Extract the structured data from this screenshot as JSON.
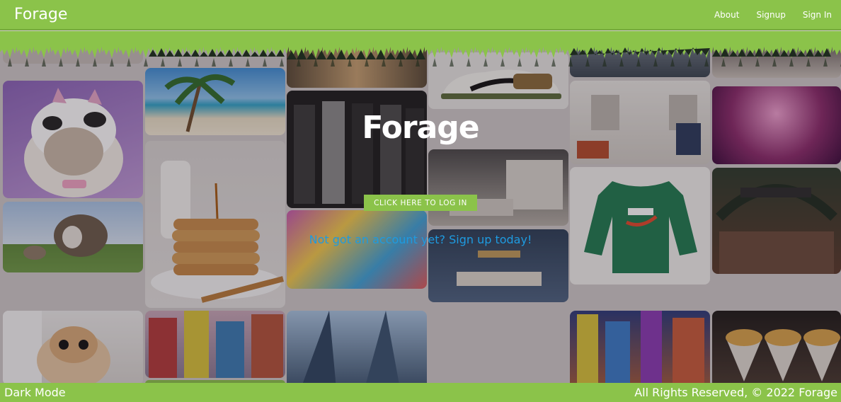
{
  "navbar": {
    "brand": "Forage",
    "links": [
      {
        "label": "About"
      },
      {
        "label": "Signup"
      },
      {
        "label": "Sign In"
      }
    ]
  },
  "hero": {
    "title": "Forage",
    "login_button": "CLICK HERE TO LOG IN",
    "signup_prompt": "Not got an account yet? Sign up today!"
  },
  "footer": {
    "dark_mode_label": "Dark Mode",
    "copyright": "All Rights Reserved, © 2022 Forage"
  },
  "colors": {
    "accent": "#8bc34a",
    "link": "#1e9be0"
  }
}
